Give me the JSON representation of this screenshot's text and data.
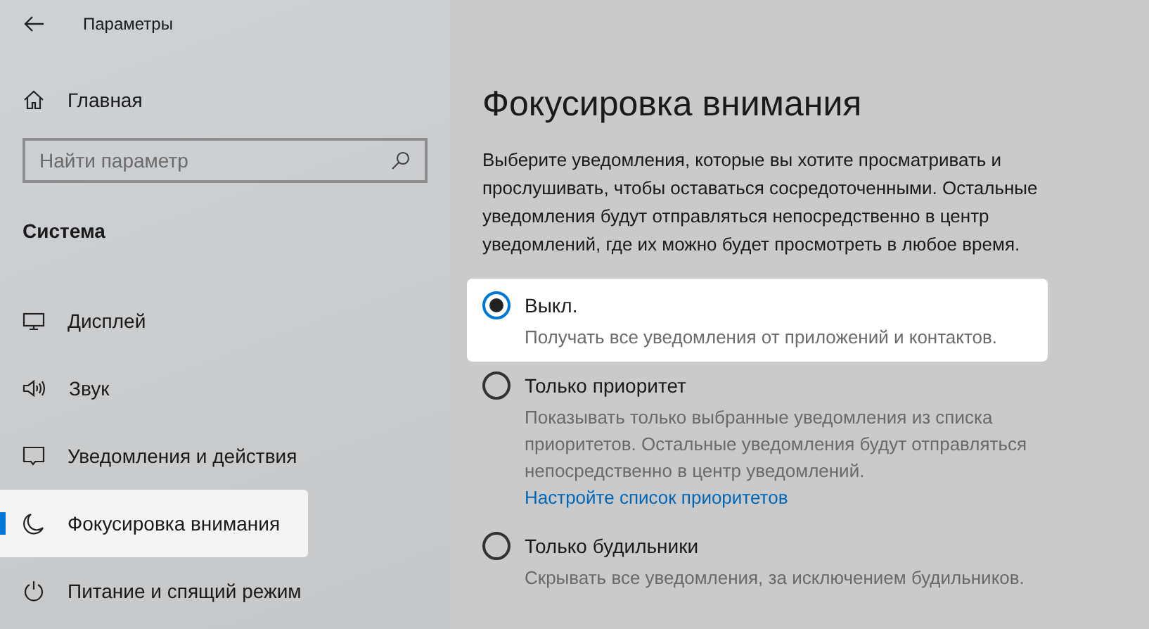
{
  "window": {
    "title": "Параметры"
  },
  "sidebar": {
    "home": {
      "label": "Главная",
      "kind": "home"
    },
    "search": {
      "placeholder": "Найти параметр"
    },
    "section": "Система",
    "items": [
      {
        "label": "Дисплей",
        "kind": "display",
        "selected": false
      },
      {
        "label": "Звук",
        "kind": "sound",
        "selected": false
      },
      {
        "label": "Уведомления и действия",
        "kind": "notifications",
        "selected": false
      },
      {
        "label": "Фокусировка внимания",
        "kind": "moon",
        "selected": true
      },
      {
        "label": "Питание и спящий режим",
        "kind": "power",
        "selected": false
      }
    ]
  },
  "main": {
    "title": "Фокусировка внимания",
    "description": "Выберите уведомления, которые вы хотите просматривать и прослушивать, чтобы оставаться сосредоточенными. Остальные уведомления будут отправляться непосредственно в центр уведомлений, где их можно будет просмотреть в любое время.",
    "options": [
      {
        "label": "Выкл.",
        "description": "Получать все уведомления от приложений и контактов.",
        "selected": true
      },
      {
        "label": "Только приоритет",
        "description": "Показывать только выбранные уведомления из списка приоритетов. Остальные уведомления будут отправляться непосредственно в центр уведомлений.",
        "link": "Настройте список приоритетов",
        "selected": false
      },
      {
        "label": "Только будильники",
        "description": "Скрывать все уведомления, за исключением будильников.",
        "selected": false
      }
    ]
  }
}
